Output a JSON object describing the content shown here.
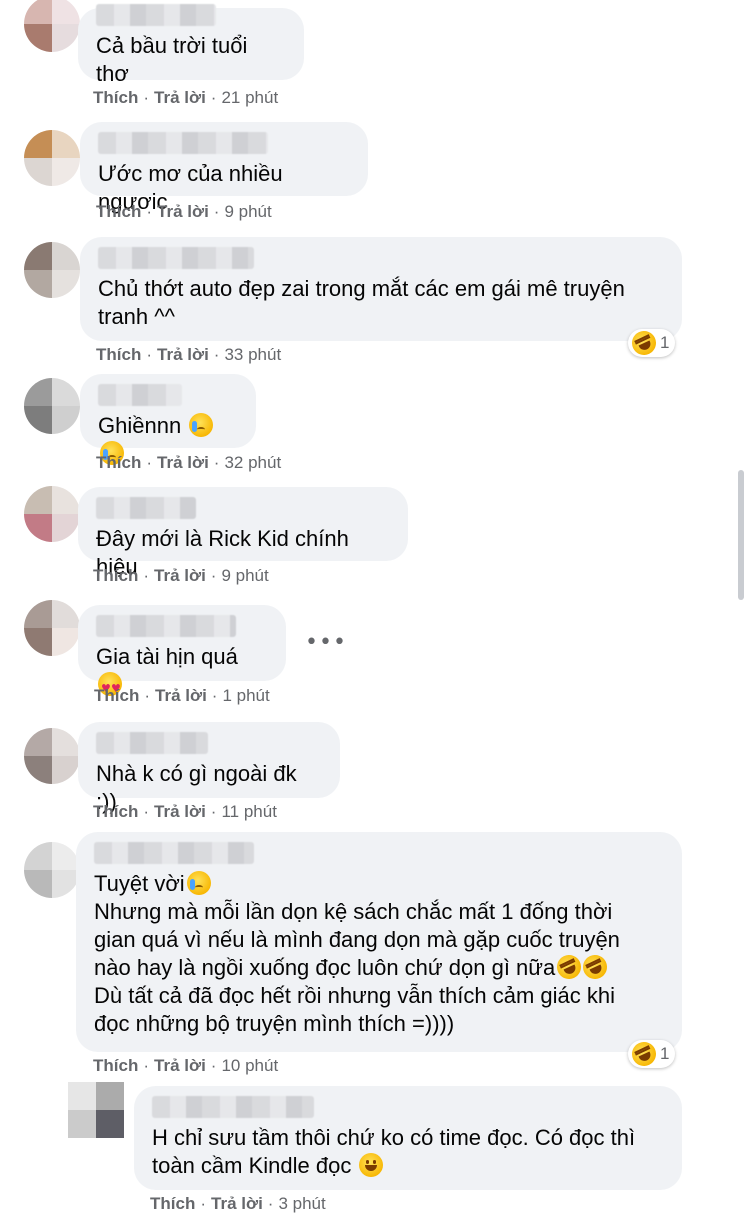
{
  "comments": [
    {
      "text": "Cả bầu trời tuổi thơ",
      "time": "21 phút"
    },
    {
      "text": "Ước mơ của nhiều ngươic",
      "time": "9 phút"
    },
    {
      "text": "Chủ thớt auto đẹp zai trong mắt các em gái mê truyện\ntranh ^^",
      "time": "33 phút",
      "reaction_count": "1"
    },
    {
      "text": "Ghiềnnn",
      "time": "32 phút"
    },
    {
      "text": "Đây mới là Rick Kid chính hiệu",
      "time": "9 phút"
    },
    {
      "text": "Gia tài hịn quá",
      "time": "1 phút"
    },
    {
      "text": "Nhà k có gì ngoài đk :))",
      "time": "11 phút"
    },
    {
      "text": "Tuyệt vời",
      "text2": "Nhưng mà mỗi lần dọn kệ sách chắc mất 1 đống thời\ngian quá vì nếu là mình đang dọn mà gặp cuốc truyện\nnào hay là ngồi xuống đọc luôn chứ dọn gì nữa",
      "text3": "Dù tất cả đã đọc hết rồi nhưng vẫn thích cảm giác khi\nđọc những bộ truyện mình thích =))))",
      "time": "10 phút",
      "reaction_count": "1"
    },
    {
      "text": "H chỉ sưu tầm thôi chứ ko có time đọc. Có đọc thì\ntoàn cầm Kindle đọc",
      "time": "3 phút"
    }
  ],
  "actions": {
    "like": "Thích",
    "reply": "Trả lời",
    "separator": "·"
  },
  "more_options": "•••",
  "colors": {
    "bubble": "#f0f2f5",
    "meta": "#65676b",
    "text": "#050505"
  }
}
